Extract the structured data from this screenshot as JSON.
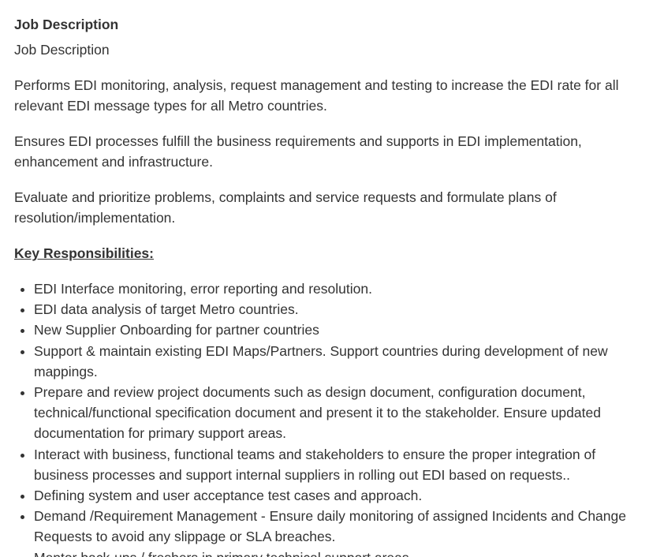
{
  "job": {
    "heading": "Job Description",
    "subheading": "Job Description",
    "paragraphs": [
      "Performs EDI monitoring, analysis, request management and testing to increase the EDI rate for all relevant EDI message types for all Metro countries.",
      "Ensures EDI processes fulfill the business requirements and supports in EDI implementation, enhancement and infrastructure.",
      "Evaluate and prioritize problems, complaints and service requests and formulate plans of resolution/implementation."
    ],
    "responsibilities_heading": "Key Responsibilities:",
    "responsibilities": [
      "EDI Interface monitoring, error reporting and resolution.",
      "EDI data analysis of target Metro countries.",
      "New Supplier Onboarding for partner countries",
      "Support & maintain existing EDI Maps/Partners. Support countries during development of new mappings.",
      "Prepare and review project documents such as design document, configuration document, technical/functional specification document and present it to the stakeholder. Ensure updated documentation for primary support areas.",
      "Interact with business, functional teams and stakeholders to ensure the proper integration of business processes and support internal suppliers in rolling out EDI based on requests..",
      "Defining system and user acceptance test cases and approach.",
      "Demand /Requirement Management - Ensure daily monitoring of assigned Incidents and Change Requests to avoid any slippage or SLA breaches.",
      "Mentor back-ups / freshers in primary technical support areas."
    ]
  }
}
